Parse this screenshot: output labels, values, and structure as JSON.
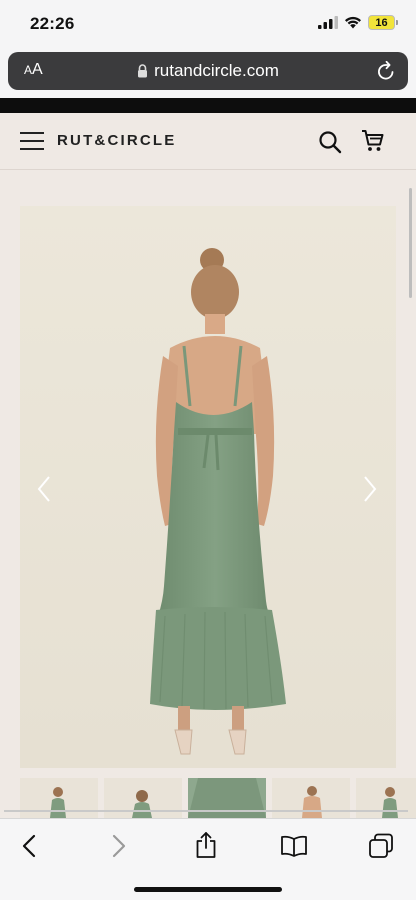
{
  "status_bar": {
    "time": "22:26",
    "battery": "16",
    "icons": [
      "cellular-signal-icon",
      "wifi-icon",
      "battery-icon"
    ]
  },
  "browser": {
    "text_size_label_small": "A",
    "text_size_label_large": "A",
    "url": "rutandcircle.com",
    "icons": [
      "lock-icon",
      "reload-icon"
    ]
  },
  "site_header": {
    "logo": "RUT&CIRCLE",
    "icons": [
      "hamburger-menu-icon",
      "search-icon",
      "cart-icon"
    ]
  },
  "product_gallery": {
    "image_subject": "woman in sage green halter maxi dress, back view",
    "thumbnail_count": 5,
    "icons": [
      "chevron-left-icon",
      "chevron-right-icon"
    ]
  },
  "colors": {
    "dress": "#7c9a7c",
    "page_bg": "#efe9e4",
    "photo_bg": "#ebe6d9",
    "battery": "#f2e43a"
  },
  "toolbar": {
    "icons": [
      "back-icon",
      "forward-icon",
      "share-icon",
      "bookmarks-icon",
      "tabs-icon"
    ]
  }
}
